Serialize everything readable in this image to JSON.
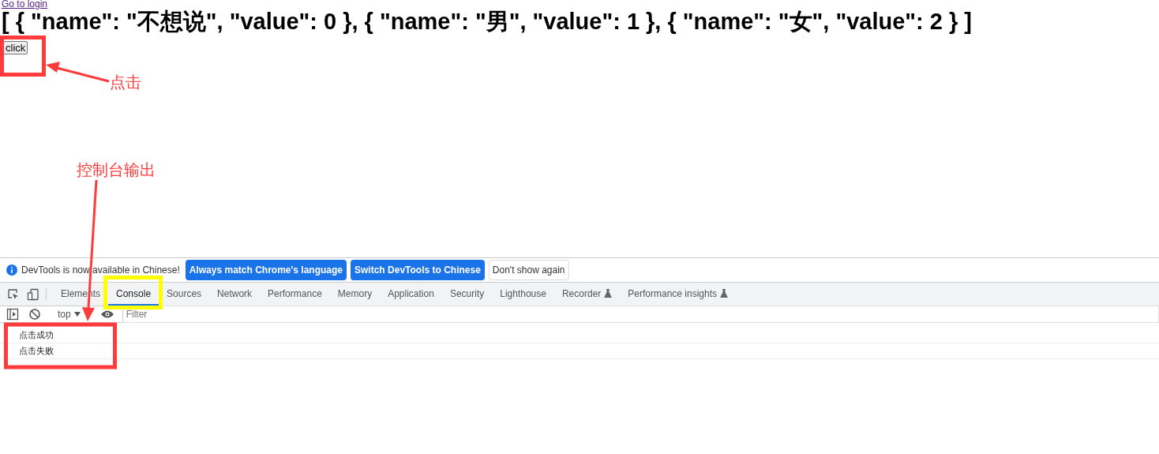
{
  "page": {
    "link": "Go to login",
    "heading": "[ { \"name\": \"不想说\", \"value\": 0 }, { \"name\": \"男\", \"value\": 1 }, { \"name\": \"女\", \"value\": 2 } ]",
    "button": "click"
  },
  "devtools": {
    "infobar": {
      "message": "DevTools is now available in Chinese!",
      "buttons": [
        {
          "label": "Always match Chrome's language",
          "kind": "primary"
        },
        {
          "label": "Switch DevTools to Chinese",
          "kind": "primary"
        },
        {
          "label": "Don't show again",
          "kind": "secondary"
        }
      ]
    },
    "tabs": [
      {
        "label": "Elements",
        "selected": false,
        "experimental": false
      },
      {
        "label": "Console",
        "selected": true,
        "experimental": false
      },
      {
        "label": "Sources",
        "selected": false,
        "experimental": false
      },
      {
        "label": "Network",
        "selected": false,
        "experimental": false
      },
      {
        "label": "Performance",
        "selected": false,
        "experimental": false
      },
      {
        "label": "Memory",
        "selected": false,
        "experimental": false
      },
      {
        "label": "Application",
        "selected": false,
        "experimental": false
      },
      {
        "label": "Security",
        "selected": false,
        "experimental": false
      },
      {
        "label": "Lighthouse",
        "selected": false,
        "experimental": false
      },
      {
        "label": "Recorder",
        "selected": false,
        "experimental": true
      },
      {
        "label": "Performance insights",
        "selected": false,
        "experimental": true
      }
    ],
    "toolbar": {
      "context": "top",
      "filter_placeholder": "Filter"
    },
    "messages": [
      "点击成功",
      "点击失败"
    ]
  },
  "annotations": [
    {
      "label": "点击"
    },
    {
      "label": "控制台输出"
    }
  ]
}
